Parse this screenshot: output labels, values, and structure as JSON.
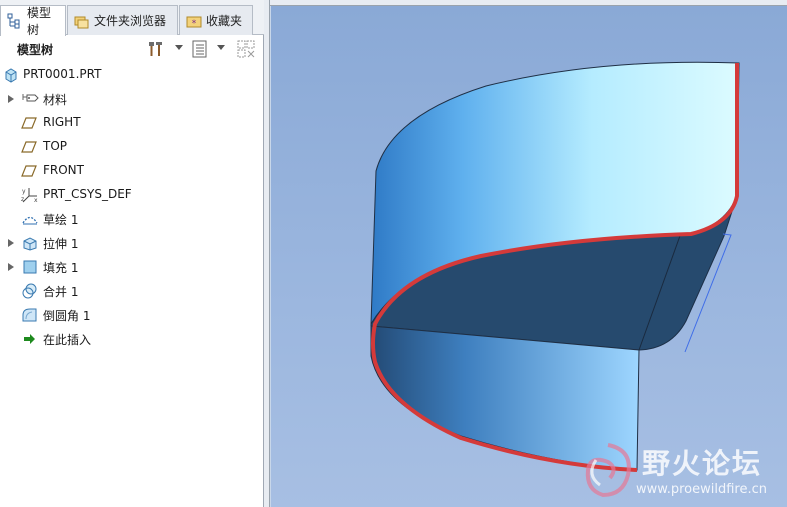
{
  "tabs": [
    {
      "label": "模型树",
      "icon": "model-tree-icon",
      "active": true
    },
    {
      "label": "文件夹浏览器",
      "icon": "folder-browser-icon",
      "active": false
    },
    {
      "label": "收藏夹",
      "icon": "favorites-icon",
      "active": false
    }
  ],
  "toolbar": {
    "title": "模型树",
    "settings_icon": "tools-icon",
    "show_icon": "list-icon",
    "filter_icon": "filter-grid-icon"
  },
  "tree": {
    "root": {
      "label": "PRT0001.PRT",
      "icon": "part-icon"
    },
    "items": [
      {
        "label": "材料",
        "icon": "material-tag-icon",
        "expandable": true
      },
      {
        "label": "RIGHT",
        "icon": "datum-plane-icon",
        "expandable": false
      },
      {
        "label": "TOP",
        "icon": "datum-plane-icon",
        "expandable": false
      },
      {
        "label": "FRONT",
        "icon": "datum-plane-icon",
        "expandable": false
      },
      {
        "label": "PRT_CSYS_DEF",
        "icon": "coordinate-system-icon",
        "expandable": false
      },
      {
        "label": "草绘 1",
        "icon": "sketch-icon",
        "expandable": false
      },
      {
        "label": "拉伸 1",
        "icon": "extrude-icon",
        "expandable": true
      },
      {
        "label": "填充 1",
        "icon": "fill-icon",
        "expandable": true
      },
      {
        "label": "合并 1",
        "icon": "merge-icon",
        "expandable": false
      },
      {
        "label": "倒圆角 1",
        "icon": "round-icon",
        "expandable": false
      },
      {
        "label": "在此插入",
        "icon": "insert-here-arrow-icon",
        "expandable": false
      }
    ]
  },
  "watermark": {
    "title": "野火论坛",
    "url": "www.proewildfire.cn"
  },
  "colors": {
    "viewport_bg": "#8aa9d6",
    "surface_light": "#c8f6ff",
    "surface_dark": "#264a6e",
    "edge_highlight": "#d43a3a"
  }
}
